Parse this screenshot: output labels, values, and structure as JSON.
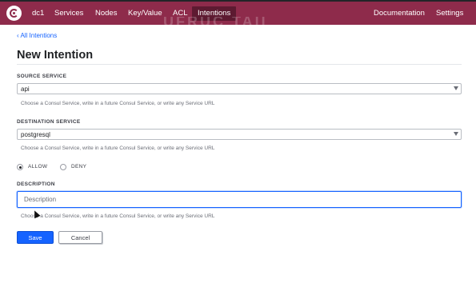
{
  "nav": {
    "logo_icon": "consul-logo-icon",
    "datacenter": "dc1",
    "items": [
      "Services",
      "Nodes",
      "Key/Value",
      "ACL",
      "Intentions"
    ],
    "active": "Intentions",
    "right_items": [
      "Documentation",
      "Settings"
    ],
    "watermark": "UFRUC TAII"
  },
  "breadcrumb": "‹ All Intentions",
  "title": "New Intention",
  "source": {
    "label": "SOURCE SERVICE",
    "value": "api",
    "help": "Choose a Consul Service, write in a future Consul Service, or write any Service URL"
  },
  "destination": {
    "label": "DESTINATION SERVICE",
    "value": "postgresql",
    "help": "Choose a Consul Service, write in a future Consul Service, or write any Service URL"
  },
  "action": {
    "allow_label": "ALLOW",
    "deny_label": "DENY",
    "selected": "ALLOW"
  },
  "description": {
    "label": "DESCRIPTION",
    "placeholder": "Description",
    "help": "Choose a Consul Service, write in a future Consul Service, or write any Service URL"
  },
  "buttons": {
    "save": "Save",
    "cancel": "Cancel"
  },
  "colors": {
    "nav_bg": "#8e2b4b",
    "nav_active": "#5d1a31",
    "accent": "#1563ff"
  }
}
